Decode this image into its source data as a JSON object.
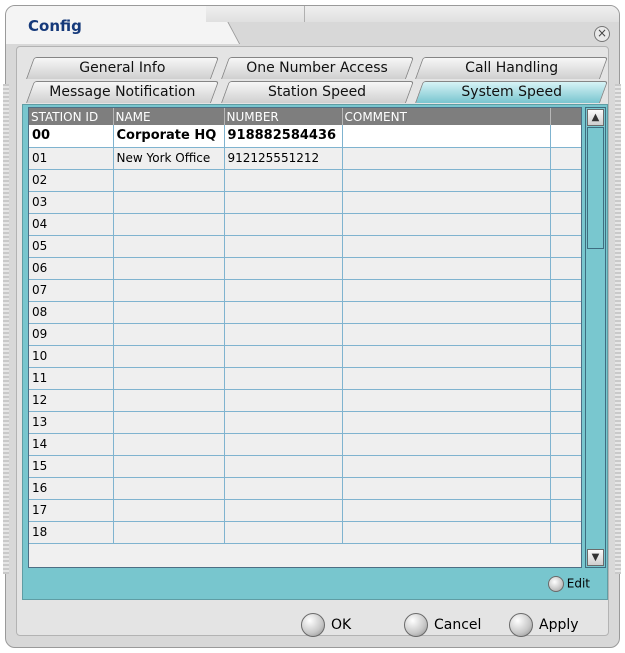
{
  "window": {
    "title": "Config",
    "close_icon": "×"
  },
  "tabs_row1": [
    "General Info",
    "One Number Access",
    "Call Handling"
  ],
  "tabs_row2": [
    "Message Notification",
    "Station Speed",
    "System Speed"
  ],
  "active_tab": "System Speed",
  "table": {
    "headers": [
      "STATION ID",
      "NAME",
      "NUMBER",
      "COMMENT",
      ""
    ],
    "rows": [
      [
        "00",
        "Corporate HQ",
        "918882584436",
        "",
        ""
      ],
      [
        "01",
        "New York Office",
        "912125551212",
        "",
        ""
      ],
      [
        "02",
        "",
        "",
        "",
        ""
      ],
      [
        "03",
        "",
        "",
        "",
        ""
      ],
      [
        "04",
        "",
        "",
        "",
        ""
      ],
      [
        "05",
        "",
        "",
        "",
        ""
      ],
      [
        "06",
        "",
        "",
        "",
        ""
      ],
      [
        "07",
        "",
        "",
        "",
        ""
      ],
      [
        "08",
        "",
        "",
        "",
        ""
      ],
      [
        "09",
        "",
        "",
        "",
        ""
      ],
      [
        "10",
        "",
        "",
        "",
        ""
      ],
      [
        "11",
        "",
        "",
        "",
        ""
      ],
      [
        "12",
        "",
        "",
        "",
        ""
      ],
      [
        "13",
        "",
        "",
        "",
        ""
      ],
      [
        "14",
        "",
        "",
        "",
        ""
      ],
      [
        "15",
        "",
        "",
        "",
        ""
      ],
      [
        "16",
        "",
        "",
        "",
        ""
      ],
      [
        "17",
        "",
        "",
        "",
        ""
      ],
      [
        "18",
        "",
        "",
        "",
        ""
      ]
    ],
    "selected_row": 0
  },
  "scrollbar": {
    "up_icon": "▲",
    "down_icon": "▼"
  },
  "edit_label": "Edit",
  "buttons": {
    "ok": "OK",
    "cancel": "Cancel",
    "apply": "Apply"
  },
  "colors": {
    "accent": "#79c7cf",
    "title": "#15397a",
    "header_bg": "#7e7e7e",
    "grid_line": "#7fb3cf"
  }
}
